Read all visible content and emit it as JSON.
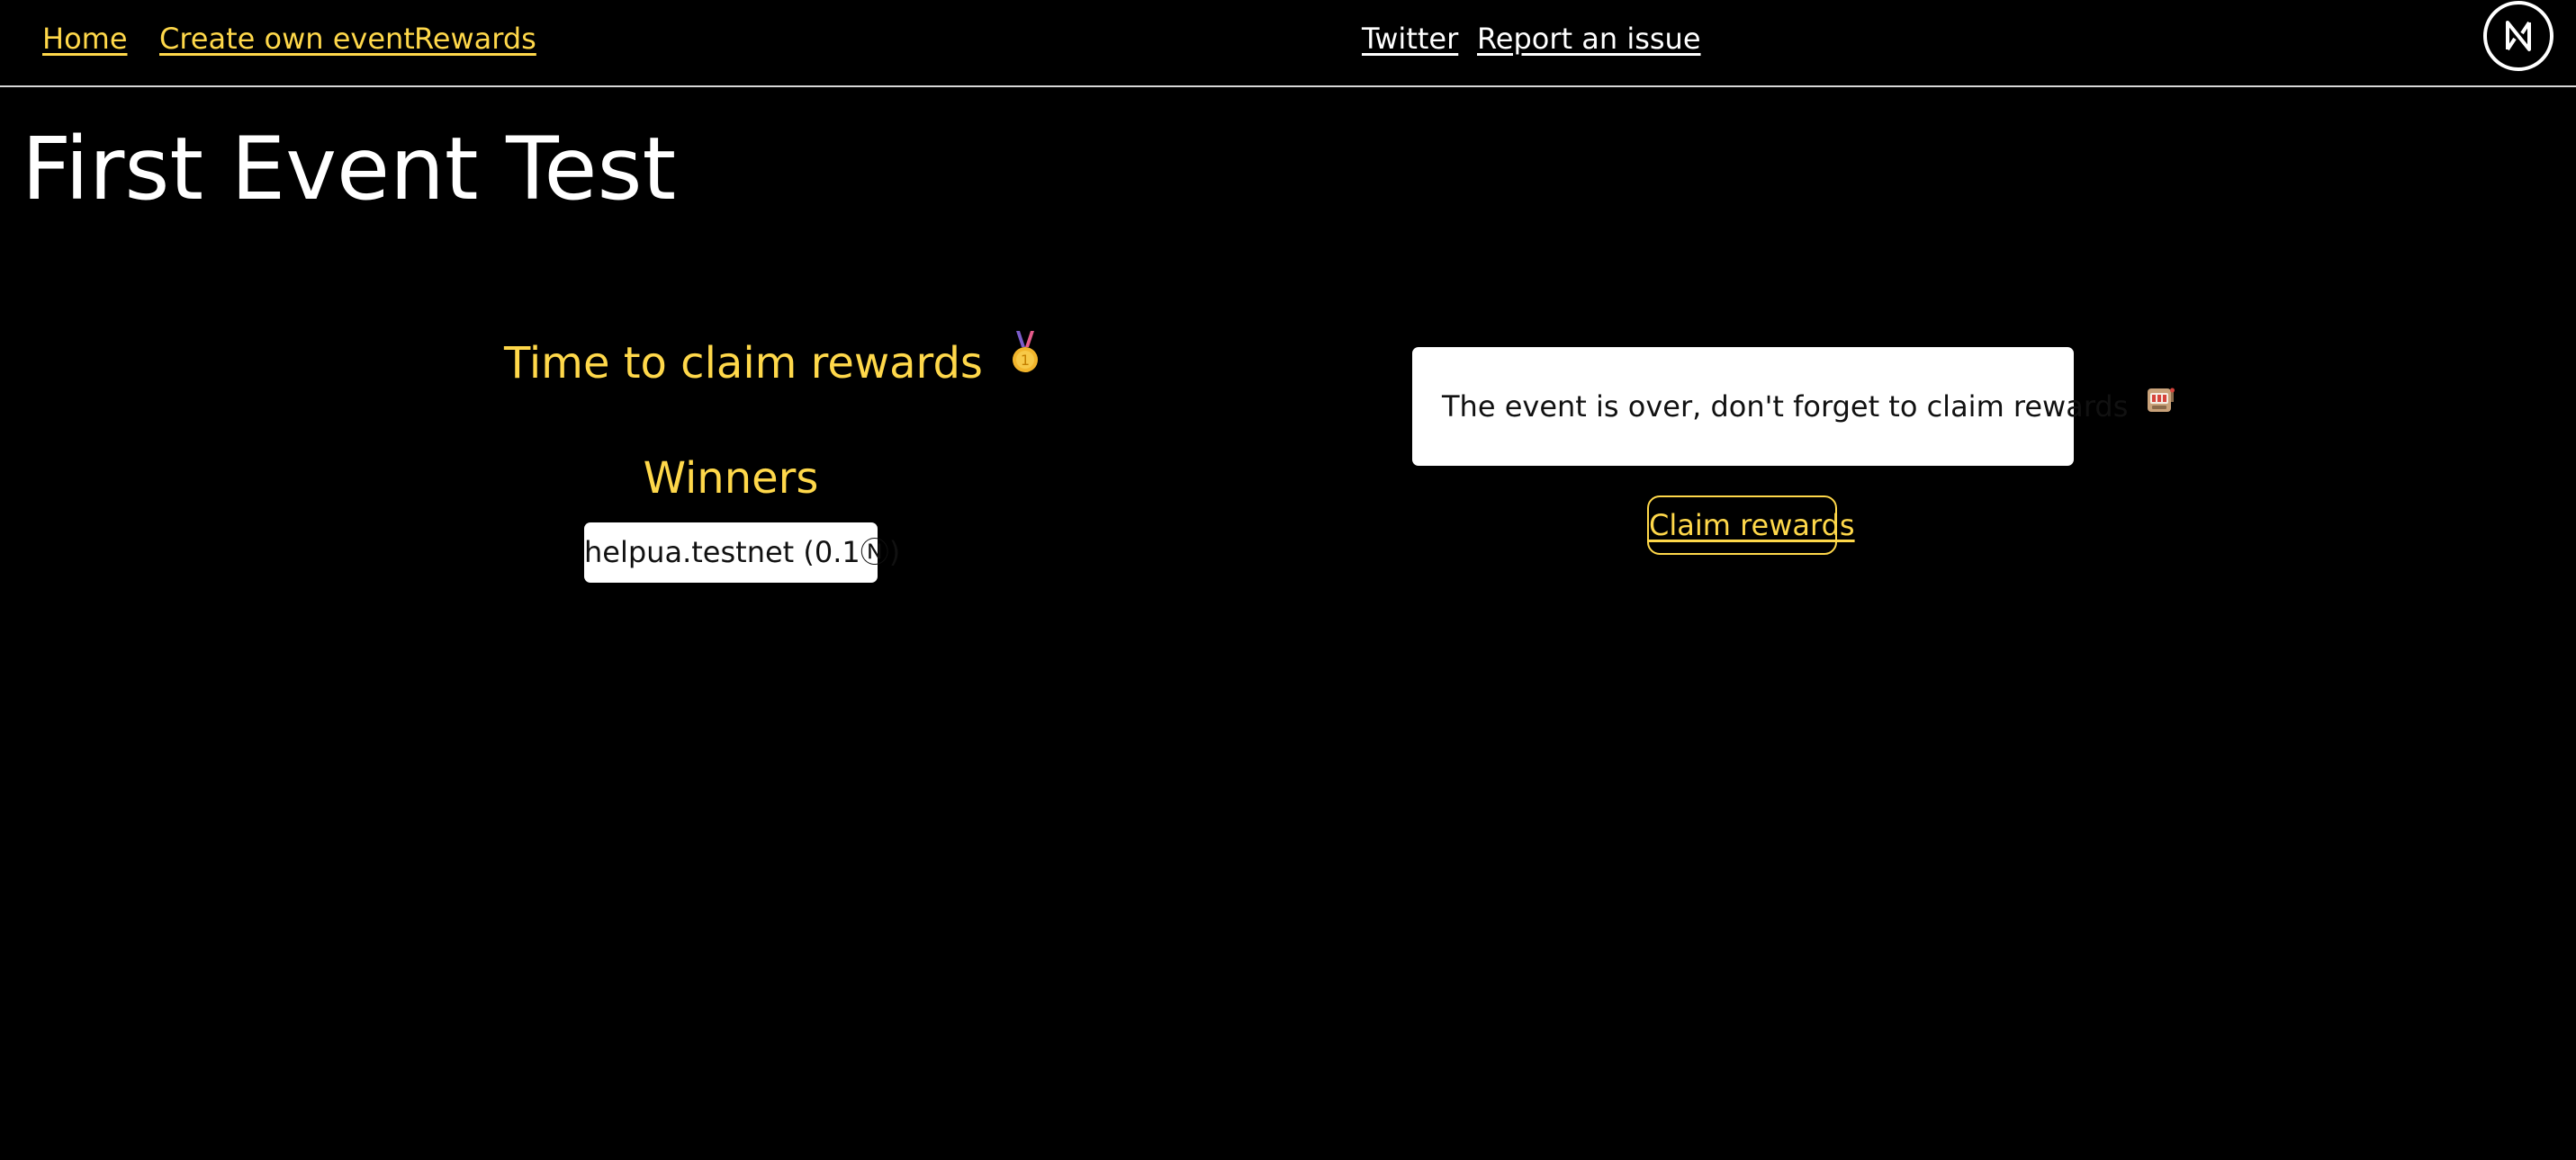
{
  "nav": {
    "left_links": [
      "Home",
      "Create own event",
      "Rewards"
    ],
    "right_links": [
      "Twitter",
      "Report an issue"
    ],
    "logo_icon": "near-logo-icon"
  },
  "event": {
    "title": "First Event Test"
  },
  "rewards_panel": {
    "heading": "Time to claim rewards",
    "heading_icon": "medal-icon",
    "winners_heading": "Winners",
    "winners": [
      "helpua.testnet (0.1Ⓝ)"
    ]
  },
  "notice": {
    "text": "The event is over, don't forget to claim rewards",
    "icon": "slot-machine-icon"
  },
  "claim_button_label": "Claim rewards",
  "colors": {
    "background": "#000000",
    "accent": "#ffd84a",
    "text": "#ffffff",
    "card": "#ffffff"
  }
}
